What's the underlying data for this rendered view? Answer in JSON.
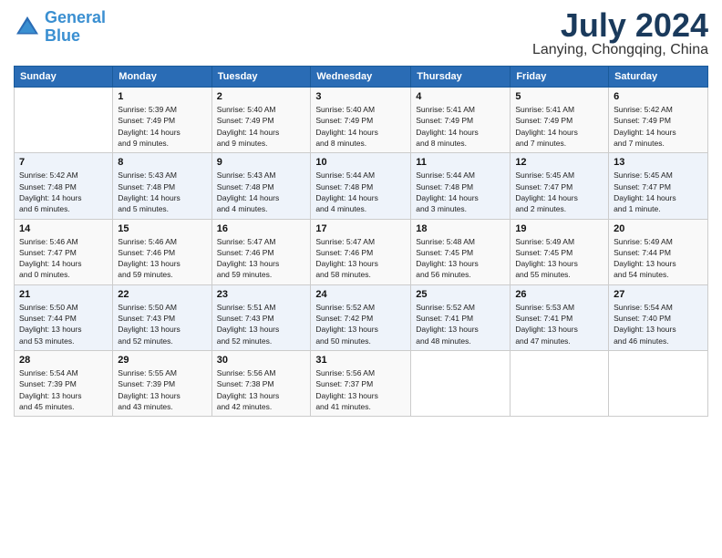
{
  "header": {
    "logo_line1": "General",
    "logo_line2": "Blue",
    "month": "July 2024",
    "location": "Lanying, Chongqing, China"
  },
  "columns": [
    "Sunday",
    "Monday",
    "Tuesday",
    "Wednesday",
    "Thursday",
    "Friday",
    "Saturday"
  ],
  "weeks": [
    [
      {
        "day": "",
        "info": ""
      },
      {
        "day": "1",
        "info": "Sunrise: 5:39 AM\nSunset: 7:49 PM\nDaylight: 14 hours\nand 9 minutes."
      },
      {
        "day": "2",
        "info": "Sunrise: 5:40 AM\nSunset: 7:49 PM\nDaylight: 14 hours\nand 9 minutes."
      },
      {
        "day": "3",
        "info": "Sunrise: 5:40 AM\nSunset: 7:49 PM\nDaylight: 14 hours\nand 8 minutes."
      },
      {
        "day": "4",
        "info": "Sunrise: 5:41 AM\nSunset: 7:49 PM\nDaylight: 14 hours\nand 8 minutes."
      },
      {
        "day": "5",
        "info": "Sunrise: 5:41 AM\nSunset: 7:49 PM\nDaylight: 14 hours\nand 7 minutes."
      },
      {
        "day": "6",
        "info": "Sunrise: 5:42 AM\nSunset: 7:49 PM\nDaylight: 14 hours\nand 7 minutes."
      }
    ],
    [
      {
        "day": "7",
        "info": "Sunrise: 5:42 AM\nSunset: 7:48 PM\nDaylight: 14 hours\nand 6 minutes."
      },
      {
        "day": "8",
        "info": "Sunrise: 5:43 AM\nSunset: 7:48 PM\nDaylight: 14 hours\nand 5 minutes."
      },
      {
        "day": "9",
        "info": "Sunrise: 5:43 AM\nSunset: 7:48 PM\nDaylight: 14 hours\nand 4 minutes."
      },
      {
        "day": "10",
        "info": "Sunrise: 5:44 AM\nSunset: 7:48 PM\nDaylight: 14 hours\nand 4 minutes."
      },
      {
        "day": "11",
        "info": "Sunrise: 5:44 AM\nSunset: 7:48 PM\nDaylight: 14 hours\nand 3 minutes."
      },
      {
        "day": "12",
        "info": "Sunrise: 5:45 AM\nSunset: 7:47 PM\nDaylight: 14 hours\nand 2 minutes."
      },
      {
        "day": "13",
        "info": "Sunrise: 5:45 AM\nSunset: 7:47 PM\nDaylight: 14 hours\nand 1 minute."
      }
    ],
    [
      {
        "day": "14",
        "info": "Sunrise: 5:46 AM\nSunset: 7:47 PM\nDaylight: 14 hours\nand 0 minutes."
      },
      {
        "day": "15",
        "info": "Sunrise: 5:46 AM\nSunset: 7:46 PM\nDaylight: 13 hours\nand 59 minutes."
      },
      {
        "day": "16",
        "info": "Sunrise: 5:47 AM\nSunset: 7:46 PM\nDaylight: 13 hours\nand 59 minutes."
      },
      {
        "day": "17",
        "info": "Sunrise: 5:47 AM\nSunset: 7:46 PM\nDaylight: 13 hours\nand 58 minutes."
      },
      {
        "day": "18",
        "info": "Sunrise: 5:48 AM\nSunset: 7:45 PM\nDaylight: 13 hours\nand 56 minutes."
      },
      {
        "day": "19",
        "info": "Sunrise: 5:49 AM\nSunset: 7:45 PM\nDaylight: 13 hours\nand 55 minutes."
      },
      {
        "day": "20",
        "info": "Sunrise: 5:49 AM\nSunset: 7:44 PM\nDaylight: 13 hours\nand 54 minutes."
      }
    ],
    [
      {
        "day": "21",
        "info": "Sunrise: 5:50 AM\nSunset: 7:44 PM\nDaylight: 13 hours\nand 53 minutes."
      },
      {
        "day": "22",
        "info": "Sunrise: 5:50 AM\nSunset: 7:43 PM\nDaylight: 13 hours\nand 52 minutes."
      },
      {
        "day": "23",
        "info": "Sunrise: 5:51 AM\nSunset: 7:43 PM\nDaylight: 13 hours\nand 52 minutes."
      },
      {
        "day": "24",
        "info": "Sunrise: 5:52 AM\nSunset: 7:42 PM\nDaylight: 13 hours\nand 50 minutes."
      },
      {
        "day": "25",
        "info": "Sunrise: 5:52 AM\nSunset: 7:41 PM\nDaylight: 13 hours\nand 48 minutes."
      },
      {
        "day": "26",
        "info": "Sunrise: 5:53 AM\nSunset: 7:41 PM\nDaylight: 13 hours\nand 47 minutes."
      },
      {
        "day": "27",
        "info": "Sunrise: 5:54 AM\nSunset: 7:40 PM\nDaylight: 13 hours\nand 46 minutes."
      }
    ],
    [
      {
        "day": "28",
        "info": "Sunrise: 5:54 AM\nSunset: 7:39 PM\nDaylight: 13 hours\nand 45 minutes."
      },
      {
        "day": "29",
        "info": "Sunrise: 5:55 AM\nSunset: 7:39 PM\nDaylight: 13 hours\nand 43 minutes."
      },
      {
        "day": "30",
        "info": "Sunrise: 5:56 AM\nSunset: 7:38 PM\nDaylight: 13 hours\nand 42 minutes."
      },
      {
        "day": "31",
        "info": "Sunrise: 5:56 AM\nSunset: 7:37 PM\nDaylight: 13 hours\nand 41 minutes."
      },
      {
        "day": "",
        "info": ""
      },
      {
        "day": "",
        "info": ""
      },
      {
        "day": "",
        "info": ""
      }
    ]
  ]
}
